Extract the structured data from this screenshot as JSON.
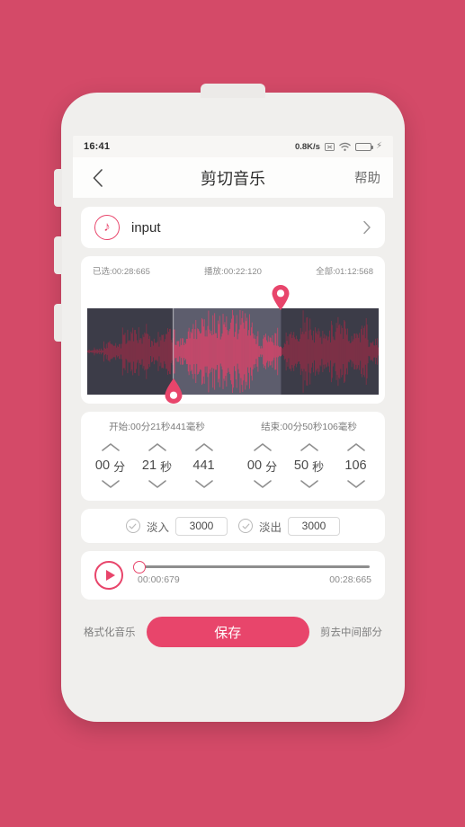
{
  "theme": {
    "page_background": "#d44a68",
    "accent": "#e8456b",
    "phone_body": "#f0efed",
    "card": "#ffffff",
    "wave_unselected_bg": "#3c3c48",
    "wave_selected_bg": "#5d5d6d",
    "wave_unselected_bar": "#8c2f46",
    "wave_selected_bar": "#d9446a",
    "battery_green": "#3fc14f"
  },
  "status_bar": {
    "time": "16:41",
    "net_speed": "0.8K/s",
    "icons": [
      "no-sim-icon",
      "wifi-icon",
      "battery-icon",
      "charging-bolt-icon"
    ],
    "battery_level": "100"
  },
  "title_bar": {
    "back_icon": "chevron-left-icon",
    "title": "剪切音乐",
    "help_label": "帮助"
  },
  "source": {
    "icon": "music-note-icon",
    "name": "input",
    "chevron_icon": "chevron-right-icon"
  },
  "wave_info": {
    "selected": "已选:00:28:665",
    "playing": "播放:00:22:120",
    "total": "全部:01:12:568"
  },
  "waveform": {
    "start_marker_pct": 29.5,
    "end_marker_pct": 66.5,
    "start_pin_icon": "pin-up-icon",
    "end_pin_icon": "pin-down-icon"
  },
  "time_editor": {
    "start": {
      "label": "开始:00分21秒441毫秒",
      "fields": [
        {
          "value": "00",
          "unit": "分"
        },
        {
          "value": "21",
          "unit": "秒"
        },
        {
          "value": "441",
          "unit": ""
        }
      ]
    },
    "end": {
      "label": "结束:00分50秒106毫秒",
      "fields": [
        {
          "value": "00",
          "unit": "分"
        },
        {
          "value": "50",
          "unit": "秒"
        },
        {
          "value": "106",
          "unit": ""
        }
      ]
    },
    "up_icon": "chevron-up-icon",
    "down_icon": "chevron-down-icon"
  },
  "fade": {
    "fade_in": {
      "check_icon": "check-circle-icon",
      "label": "淡入",
      "value": "3000",
      "checked": false
    },
    "fade_out": {
      "check_icon": "check-circle-icon",
      "label": "淡出",
      "value": "3000",
      "checked": false
    }
  },
  "player": {
    "play_icon": "play-icon",
    "current_time": "00:00:679",
    "end_time": "00:28:665",
    "progress_pct": 0
  },
  "actions": {
    "left_label": "格式化音乐",
    "save_label": "保存",
    "right_label": "剪去中间部分"
  }
}
